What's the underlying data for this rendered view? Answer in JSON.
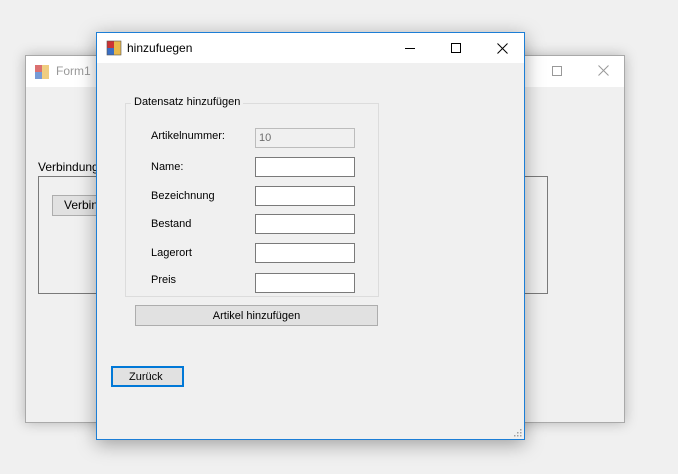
{
  "background_window": {
    "title": "Form1",
    "group_label": "Verbindung",
    "button_label": "Verbindung"
  },
  "dialog": {
    "title": "hinzufuegen",
    "group_title": "Datensatz hinzufügen",
    "fields": {
      "artikelnummer": {
        "label": "Artikelnummer:",
        "value": "10"
      },
      "name": {
        "label": "Name:",
        "value": ""
      },
      "bezeichnung": {
        "label": "Bezeichnung",
        "value": ""
      },
      "bestand": {
        "label": "Bestand",
        "value": ""
      },
      "lagerort": {
        "label": "Lagerort",
        "value": ""
      },
      "preis": {
        "label": "Preis",
        "value": ""
      }
    },
    "add_button": "Artikel hinzufügen",
    "back_button": "Zurück"
  },
  "icons": {
    "app_icon": "windows-form-icon",
    "minimize": "minimize-icon",
    "maximize": "maximize-icon",
    "close": "close-icon"
  },
  "colors": {
    "accent": "#0078d7",
    "window_bg": "#f0f0f0",
    "button_bg": "#e1e1e1"
  }
}
